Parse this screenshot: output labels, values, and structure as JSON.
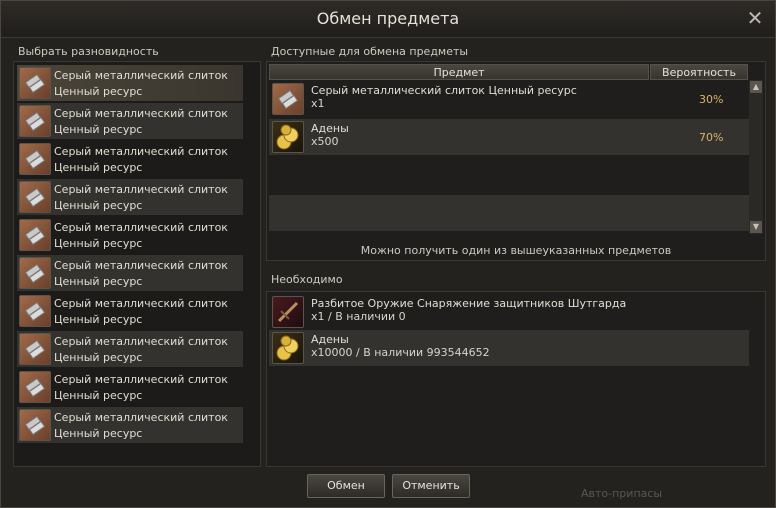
{
  "window": {
    "title": "Обмен предмета",
    "close_glyph": "✕"
  },
  "left": {
    "label": "Выбрать разновидность",
    "variants": [
      {
        "line1": "Серый металлический слиток",
        "line2": "Ценный ресурс"
      },
      {
        "line1": "Серый металлический слиток",
        "line2": "Ценный ресурс"
      },
      {
        "line1": "Серый металлический слиток",
        "line2": "Ценный ресурс"
      },
      {
        "line1": "Серый металлический слиток",
        "line2": "Ценный ресурс"
      },
      {
        "line1": "Серый металлический слиток",
        "line2": "Ценный ресурс"
      },
      {
        "line1": "Серый металлический слиток",
        "line2": "Ценный ресурс"
      },
      {
        "line1": "Серый металлический слиток",
        "line2": "Ценный ресурс"
      },
      {
        "line1": "Серый металлический слиток",
        "line2": "Ценный ресурс"
      },
      {
        "line1": "Серый металлический слиток",
        "line2": "Ценный ресурс"
      },
      {
        "line1": "Серый металлический слиток",
        "line2": "Ценный ресурс"
      }
    ]
  },
  "available": {
    "label": "Доступные для обмена предметы",
    "col_item": "Предмет",
    "col_prob": "Вероятность",
    "rows": [
      {
        "name": "Серый металлический слиток Ценный ресурс",
        "qty": "x1",
        "prob": "30%",
        "icon": "ingot-icon"
      },
      {
        "name": "Адены",
        "qty": "x500",
        "prob": "70%",
        "icon": "adena-icon"
      }
    ],
    "note": "Можно получить один из вышеуказанных предметов"
  },
  "required": {
    "label": "Необходимо",
    "rows": [
      {
        "name": "Разбитое Оружие Снаряжение защитников Шутгарда",
        "qty": "x1 / В наличии 0",
        "icon": "broken-weapon-icon"
      },
      {
        "name": "Адены",
        "qty": "x10000 / В наличии 993544652",
        "icon": "adena-icon"
      }
    ]
  },
  "buttons": {
    "exchange": "Обмен",
    "cancel": "Отменить"
  },
  "background_text": "Авто-припасы"
}
